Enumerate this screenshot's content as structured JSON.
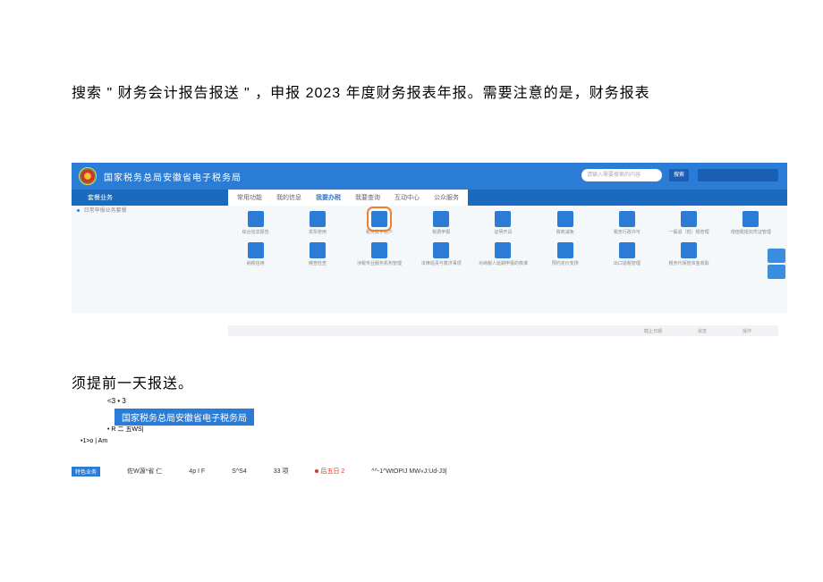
{
  "instructions": {
    "line1": "搜索 \" 财务会计报告报送 \" ，申报 2023 年度财务报表年报。需要注意的是，财务报表",
    "line2": "须提前一天报送。"
  },
  "app": {
    "title": "国家税务总局安徽省电子税务局",
    "search_placeholder": "请输入需要搜索的内容",
    "search_button": "搜索",
    "sidebar_header": "套餐业务",
    "sidebar_item": "日常申报业务套餐",
    "nav_tabs": [
      {
        "label": "常用功能",
        "active": false
      },
      {
        "label": "我的信息",
        "active": false
      },
      {
        "label": "我要办税",
        "active": true
      },
      {
        "label": "我要查询",
        "active": false
      },
      {
        "label": "互动中心",
        "active": false
      },
      {
        "label": "公众服务",
        "active": false
      }
    ],
    "grid_row1": [
      {
        "label": "综合信息报告",
        "highlight": false
      },
      {
        "label": "发票使用",
        "highlight": false
      },
      {
        "label": "税务数字账户",
        "highlight": true
      },
      {
        "label": "税费申报",
        "highlight": false
      },
      {
        "label": "证明开具",
        "highlight": false
      },
      {
        "label": "税收减免",
        "highlight": false
      },
      {
        "label": "税务行政许可",
        "highlight": false
      },
      {
        "label": "一般退（抵）税管理",
        "highlight": false
      },
      {
        "label": "增值税抵扣凭证管理",
        "highlight": false
      }
    ],
    "grid_row2": [
      {
        "label": "纳税信用",
        "highlight": false
      },
      {
        "label": "稽查检查",
        "highlight": false
      },
      {
        "label": "涉税专业服务机构管理",
        "highlight": false
      },
      {
        "label": "法律追责与救济事项",
        "highlight": false
      },
      {
        "label": "对纳税人延期申报的核准",
        "highlight": false
      },
      {
        "label": "预约定价安排",
        "highlight": false
      },
      {
        "label": "出口退税管理",
        "highlight": false
      },
      {
        "label": "税务代保管资金收取",
        "highlight": false
      },
      {
        "label": "",
        "highlight": false
      }
    ],
    "bottom_cols": [
      "截止日期",
      "状态",
      "操作"
    ]
  },
  "lower": {
    "dots": "<3 • 3",
    "bar_title": "国家税务总局安徽省电子税务局",
    "meta1": "• R 二 五WS|",
    "meta2": "•1>o   | Am",
    "footer_badge": "特色业务",
    "footer_item1": "佐W源*省 仁",
    "footer_item2": "4p I F",
    "footer_item3": "S^S4",
    "footer_count": "33 项",
    "footer_upcoming_label": "后五日 2",
    "footer_right": "^^-1^WtOPIJ MW«J:Ud-J3|"
  }
}
